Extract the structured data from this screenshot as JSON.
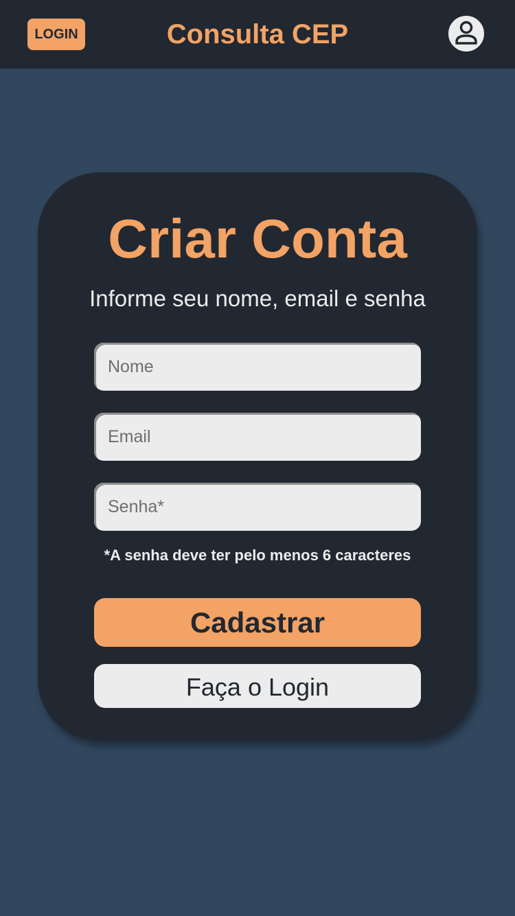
{
  "header": {
    "login_badge": "LOGIN",
    "app_title": "Consulta CEP",
    "avatar_icon": "user-icon"
  },
  "form": {
    "title": "Criar Conta",
    "subtitle": "Informe seu nome, email e senha",
    "name_placeholder": "Nome",
    "email_placeholder": "Email",
    "password_placeholder": "Senha*",
    "password_hint": "*A senha deve ter pelo menos 6 caracteres",
    "submit_label": "Cadastrar",
    "login_link_label": "Faça o Login"
  },
  "colors": {
    "background": "#31475e",
    "dark": "#222831",
    "accent": "#f2a365",
    "light": "#ececec"
  }
}
